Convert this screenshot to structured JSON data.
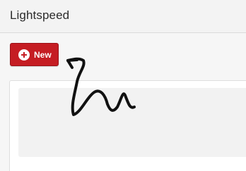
{
  "header": {
    "title": "Lightspeed"
  },
  "toolbar": {
    "new_label": "New",
    "new_icon": "plus-circle-icon",
    "accent_color": "#c51d23"
  },
  "annotation": {
    "icon": "hand-drawn-arrow"
  }
}
